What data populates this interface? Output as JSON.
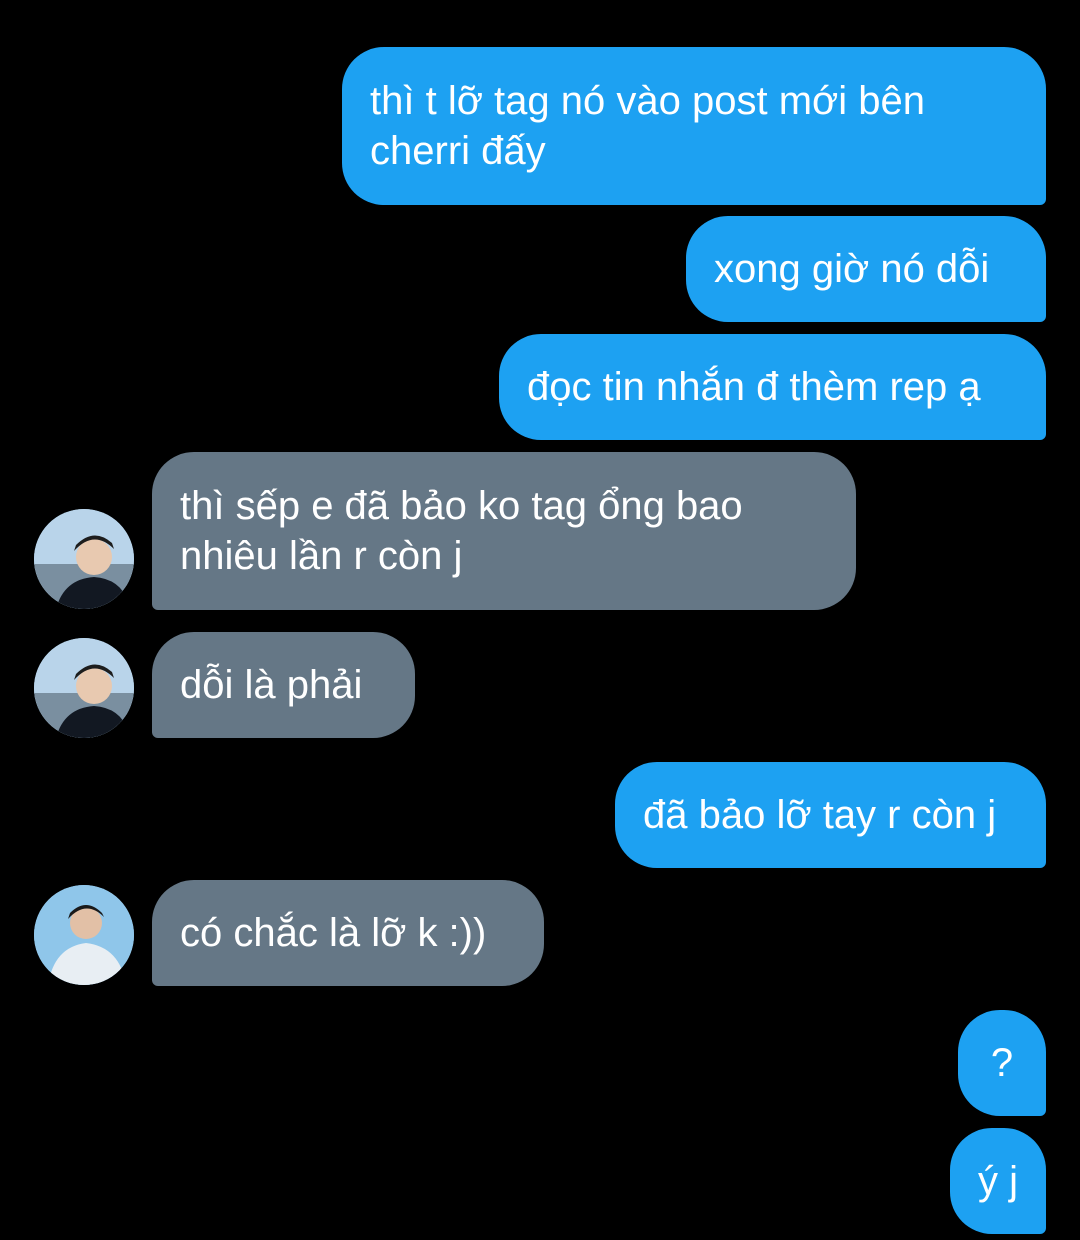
{
  "conversation": {
    "messages": [
      {
        "id": "m1",
        "sender": "me",
        "text": "thì t lỡ tag nó vào post mới bên\ncherri đấy"
      },
      {
        "id": "m2",
        "sender": "me",
        "text": "xong giờ nó dỗi"
      },
      {
        "id": "m3",
        "sender": "me",
        "text": "đọc tin nhắn đ thèm rep ạ"
      },
      {
        "id": "m4",
        "sender": "them",
        "text": "thì sếp e đã bảo ko tag ổng bao\nnhiêu lần r còn j",
        "avatar_icon": "profile-photo-icon"
      },
      {
        "id": "m5",
        "sender": "them",
        "text": "dỗi là phải",
        "avatar_icon": "profile-photo-icon"
      },
      {
        "id": "m6",
        "sender": "me",
        "text": "đã bảo lỡ tay r còn j"
      },
      {
        "id": "m7",
        "sender": "them",
        "text": "có chắc là lỡ k :))",
        "avatar_icon": "profile-photo-icon"
      },
      {
        "id": "m8",
        "sender": "me",
        "text": "?"
      },
      {
        "id": "m9",
        "sender": "me",
        "text": "ý j"
      }
    ]
  },
  "colors": {
    "background": "#000000",
    "outgoing_bubble": "#1DA1F2",
    "incoming_bubble": "#657786",
    "bubble_text": "#FFFFFF"
  }
}
